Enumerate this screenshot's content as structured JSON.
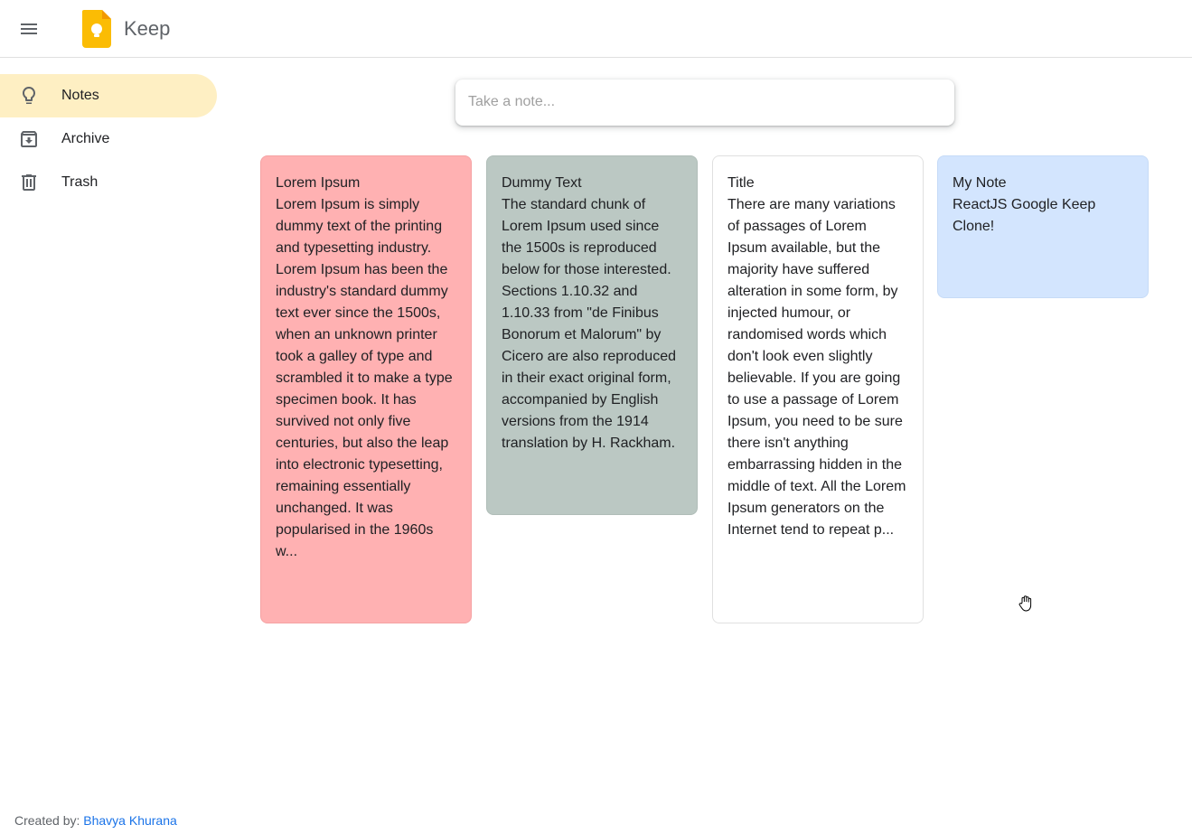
{
  "header": {
    "menu_icon": "hamburger-menu-icon",
    "logo_icon": "keep-bulb-logo-icon",
    "title": "Keep",
    "accent": "#fbbc04"
  },
  "sidebar": {
    "items": [
      {
        "label": "Notes",
        "icon": "lightbulb-icon",
        "active": true
      },
      {
        "label": "Archive",
        "icon": "archive-icon",
        "active": false
      },
      {
        "label": "Trash",
        "icon": "trash-icon",
        "active": false
      }
    ],
    "active_color": "#feefc3"
  },
  "composer": {
    "placeholder": "Take a note..."
  },
  "notes": [
    {
      "title": "Lorem Ipsum",
      "body": "Lorem Ipsum is simply dummy text of the printing and typesetting industry. Lorem Ipsum has been the industry's standard dummy text ever since the 1500s, when an unknown printer took a galley of type and scrambled it to make a type specimen book. It has survived not only five centuries, but also the leap into electronic typesetting, remaining essentially unchanged. It was popularised in the 1960s w...",
      "color": "#ffb1b2"
    },
    {
      "title": "Dummy Text",
      "body": "The standard chunk of Lorem Ipsum used since the 1500s is reproduced below for those interested. Sections 1.10.32 and 1.10.33 from \"de Finibus Bonorum et Malorum\" by Cicero are also reproduced in their exact original form, accompanied by English versions from the 1914 translation by H. Rackham.",
      "color": "#bbc8c3"
    },
    {
      "title": "Title",
      "body": "There are many variations of passages of Lorem Ipsum available, but the majority have suffered alteration in some form, by injected humour, or randomised words which don't look even slightly believable. If you are going to use a passage of Lorem Ipsum, you need to be sure there isn't anything embarrassing hidden in the middle of text. All the Lorem Ipsum generators on the Internet tend to repeat p...",
      "color": "#ffffff"
    },
    {
      "title": "My Note",
      "body": "ReactJS Google Keep Clone!",
      "color": "#d3e5fe"
    }
  ],
  "footer": {
    "prefix": "Created by: ",
    "author": "Bhavya Khurana",
    "link_color": "#1a73e8"
  },
  "cursor": {
    "icon": "hand-grab-cursor-icon"
  }
}
